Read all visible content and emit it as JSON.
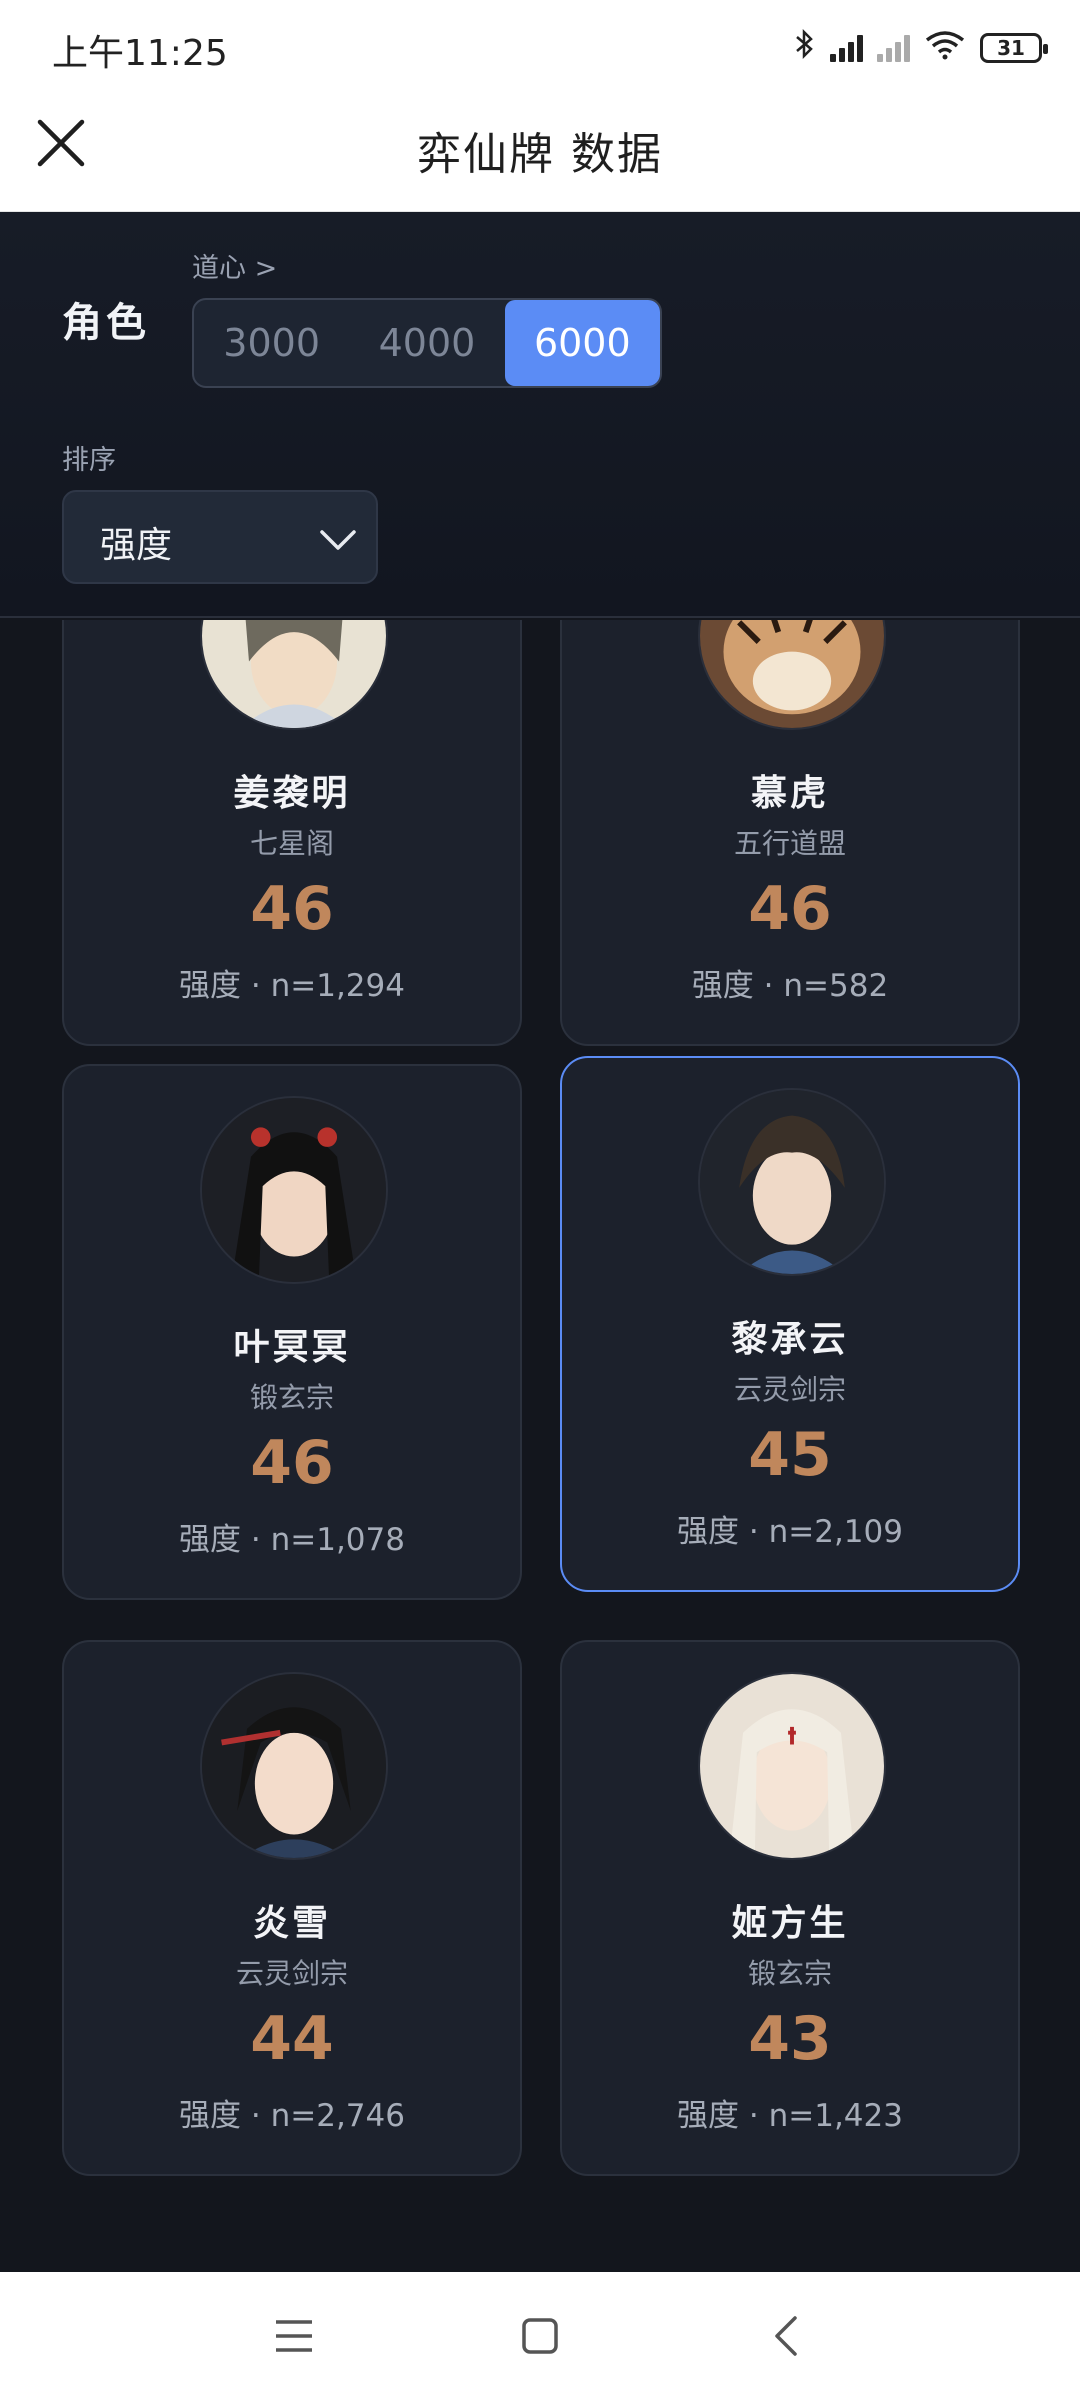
{
  "status_bar": {
    "time": "上午11:25",
    "battery": "31"
  },
  "app_bar": {
    "title": "弈仙牌 数据"
  },
  "filters": {
    "role_label": "角色",
    "daoxin_label": "道心 >",
    "segments": [
      "3000",
      "4000",
      "6000"
    ],
    "active_segment": "6000",
    "sort_label": "排序",
    "sort_value": "强度"
  },
  "cards": [
    {
      "name": "姜袭明",
      "sect": "七星阁",
      "score": "46",
      "meta": "强度 · n=1,294"
    },
    {
      "name": "慕虎",
      "sect": "五行道盟",
      "score": "46",
      "meta": "强度 · n=582"
    },
    {
      "name": "叶冥冥",
      "sect": "锻玄宗",
      "score": "46",
      "meta": "强度 · n=1,078"
    },
    {
      "name": "黎承云",
      "sect": "云灵剑宗",
      "score": "45",
      "meta": "强度 · n=2,109"
    },
    {
      "name": "炎雪",
      "sect": "云灵剑宗",
      "score": "44",
      "meta": "强度 · n=2,746"
    },
    {
      "name": "姬方生",
      "sect": "锻玄宗",
      "score": "43",
      "meta": "强度 · n=1,423"
    }
  ],
  "colors": {
    "accent": "#5b8cf5",
    "score": "#c0875c",
    "background": "#13161d",
    "card": "#1c212c"
  }
}
